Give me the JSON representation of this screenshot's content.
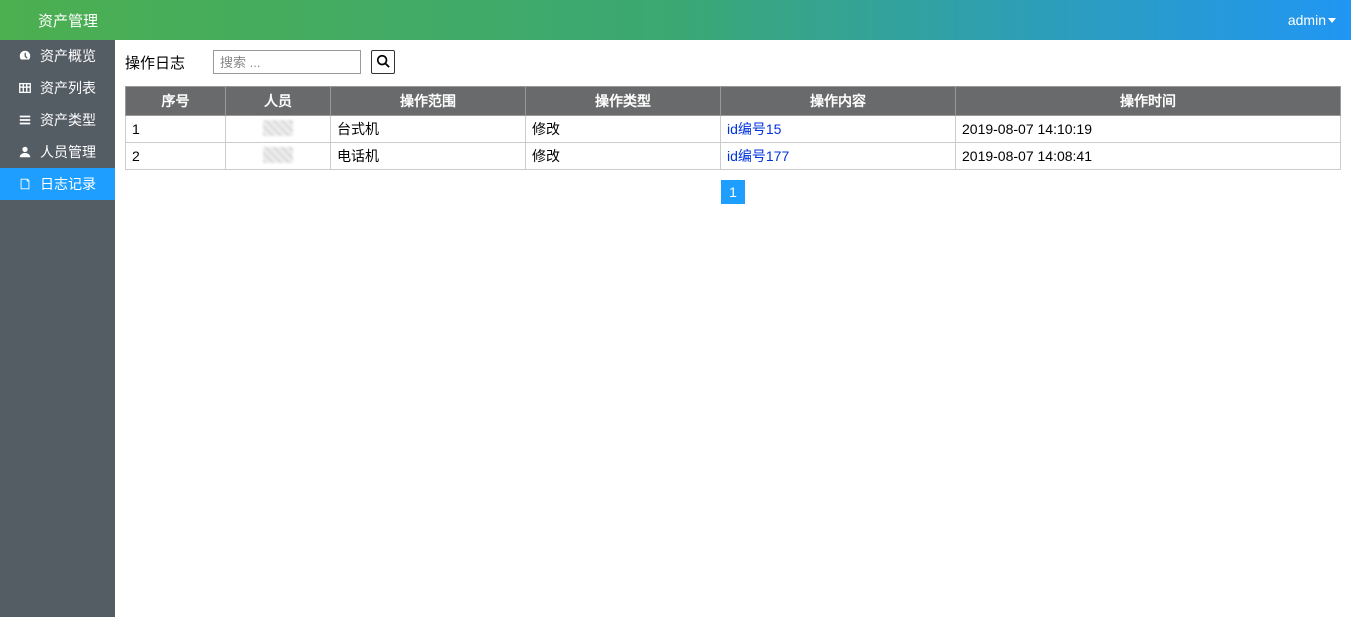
{
  "header": {
    "title": "资产管理",
    "user": "admin"
  },
  "sidebar": {
    "items": [
      {
        "label": "资产概览",
        "icon": "dashboard-icon"
      },
      {
        "label": "资产列表",
        "icon": "list-icon"
      },
      {
        "label": "资产类型",
        "icon": "category-icon"
      },
      {
        "label": "人员管理",
        "icon": "person-icon"
      },
      {
        "label": "日志记录",
        "icon": "log-icon"
      }
    ],
    "active_index": 4
  },
  "main": {
    "title": "操作日志",
    "search_placeholder": "搜索 ...",
    "table": {
      "headers": [
        "序号",
        "人员",
        "操作范围",
        "操作类型",
        "操作内容",
        "操作时间"
      ],
      "rows": [
        {
          "seq": "1",
          "person": "",
          "scope": "台式机",
          "type": "修改",
          "content": "id编号15",
          "time": "2019-08-07 14:10:19"
        },
        {
          "seq": "2",
          "person": "",
          "scope": "电话机",
          "type": "修改",
          "content": "id编号177",
          "time": "2019-08-07 14:08:41"
        }
      ]
    },
    "pagination": {
      "current": "1"
    }
  }
}
